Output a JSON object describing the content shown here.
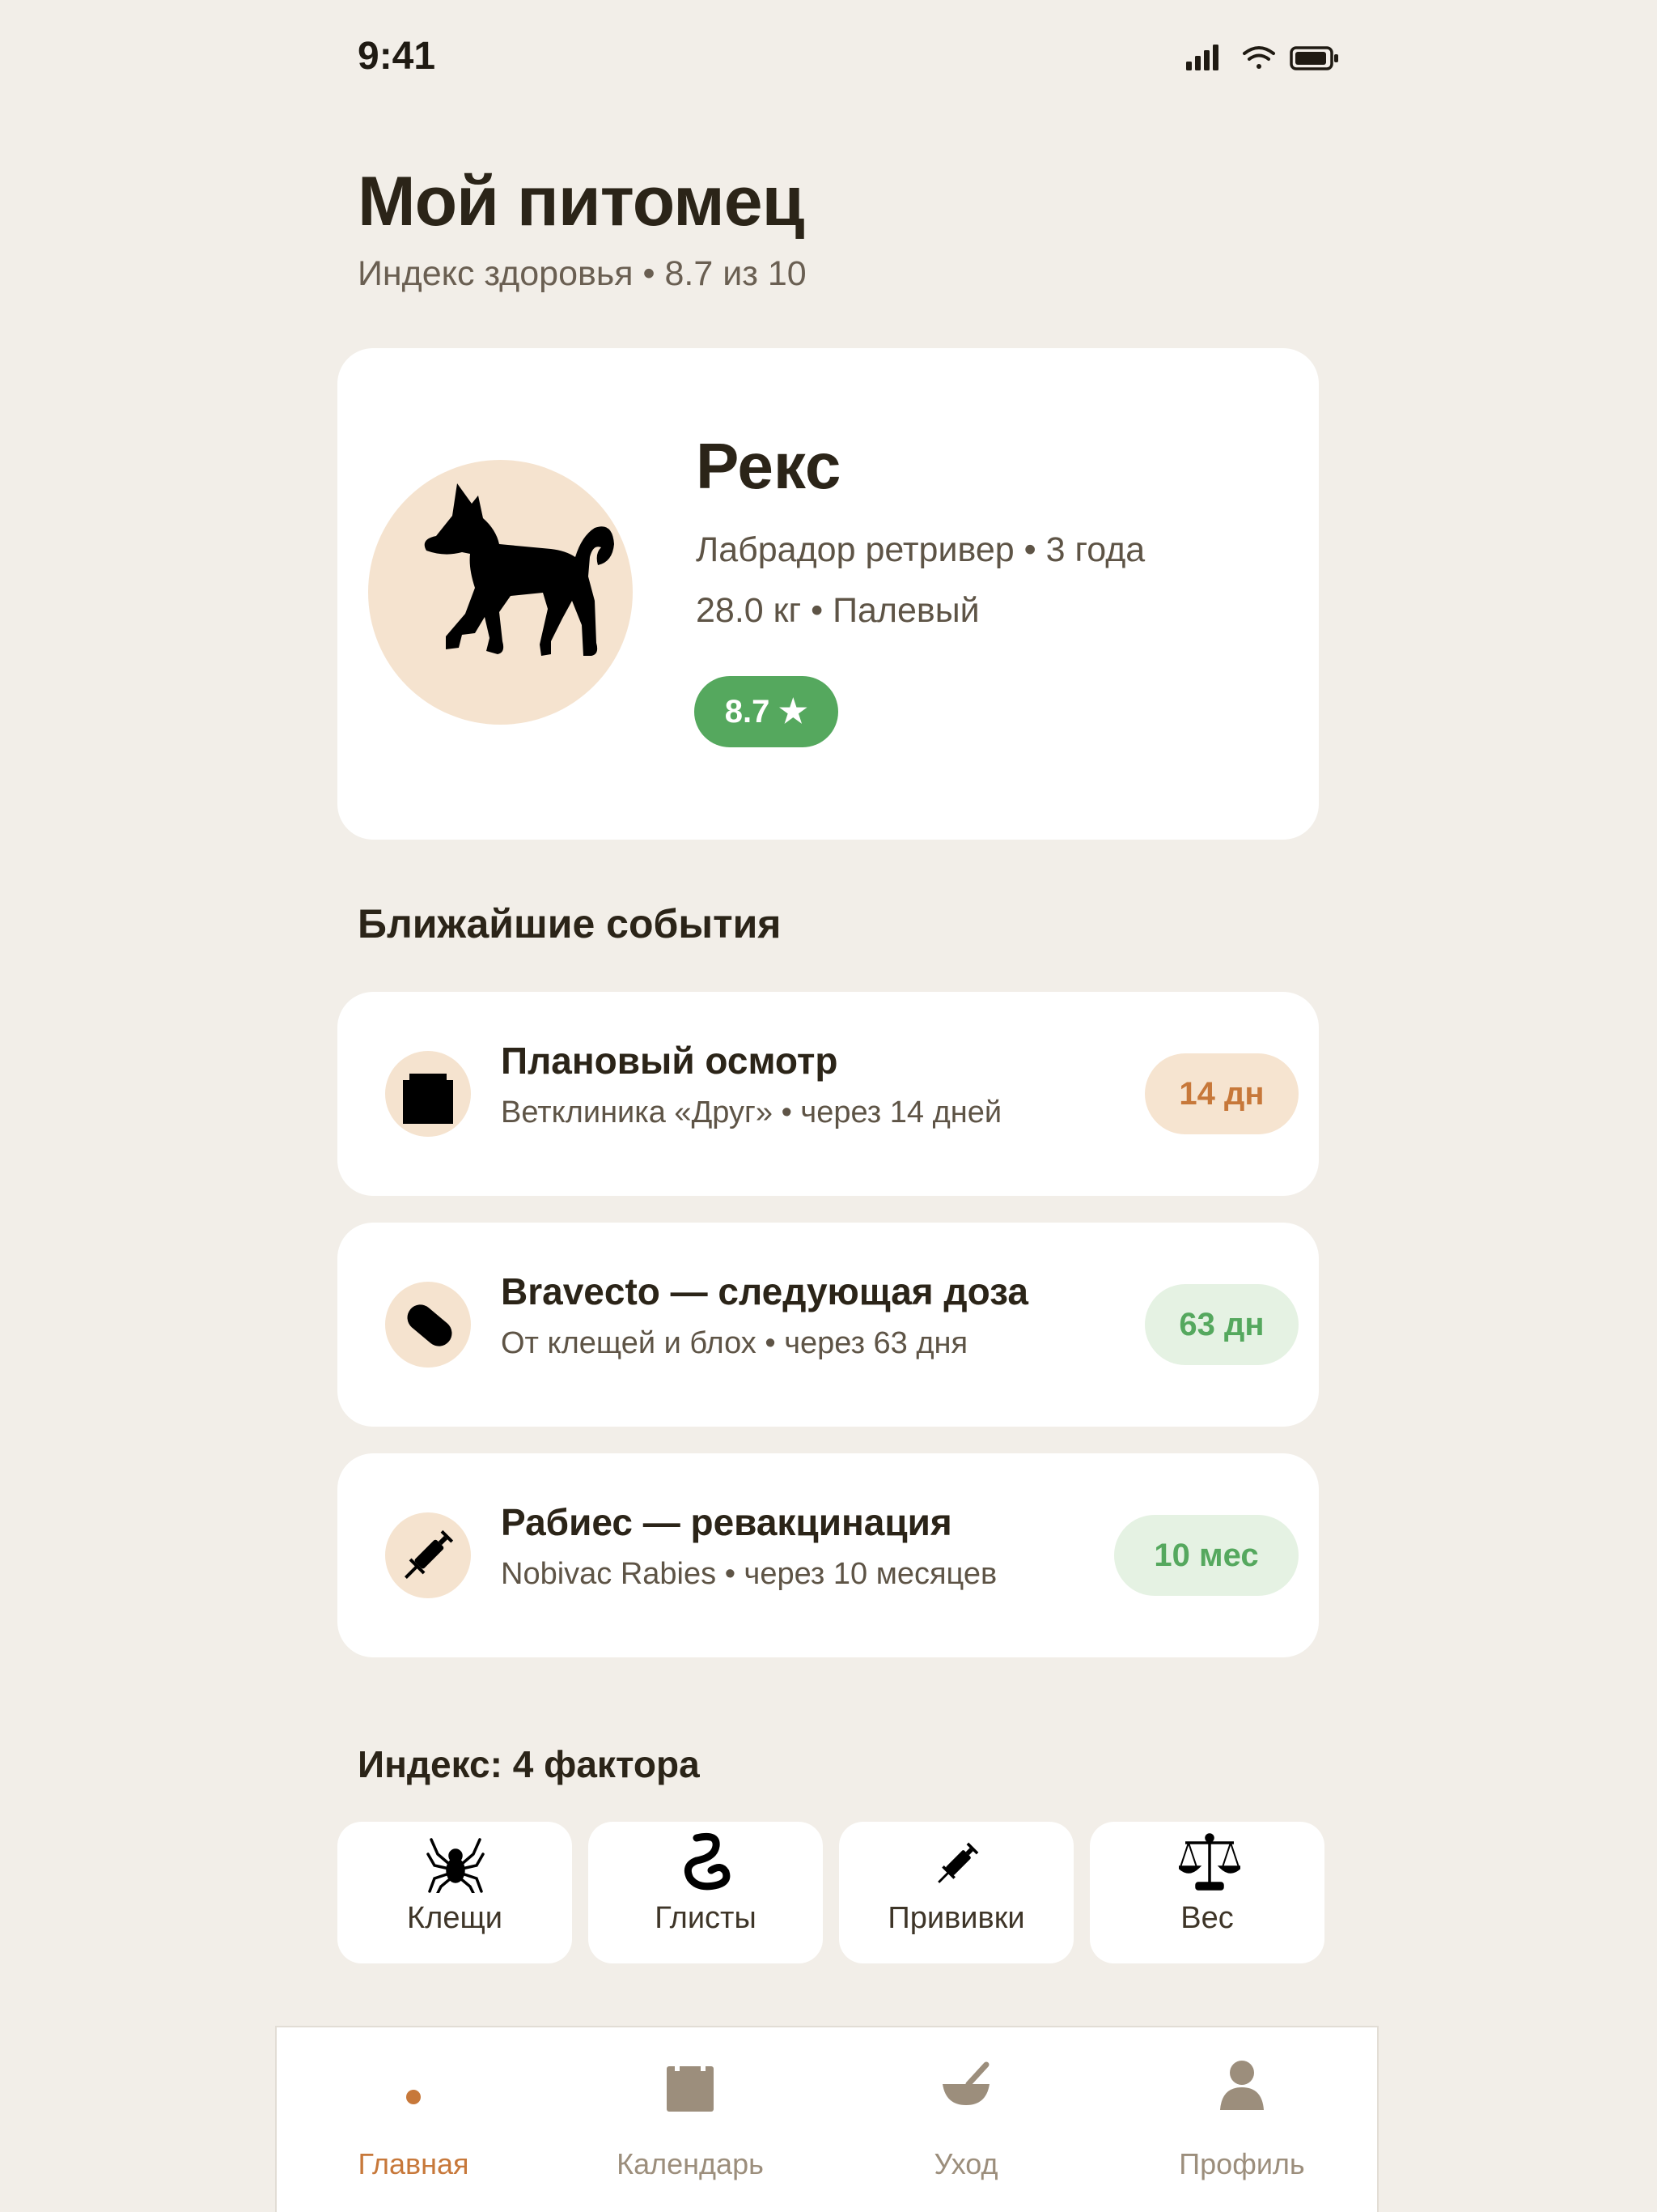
{
  "status_bar": {
    "time": "9:41"
  },
  "header": {
    "title": "Мой питомец",
    "subtitle": "Индекс здоровья • 8.7 из 10"
  },
  "pet": {
    "name": "Рекс",
    "details_line1": "Лабрадор ретривер • 3 года",
    "details_line2": "28.0 кг • Палевый",
    "score_badge": "8.7 ★",
    "avatar_icon": "dog-silhouette-icon"
  },
  "events_section": {
    "title": "Ближайшие события",
    "items": [
      {
        "title": "Плановый осмотр",
        "subtitle": "Ветклиника «Друг» • через 14 дней",
        "badge": "14 дн",
        "icon": "clinic-icon",
        "badge_color": "#C7783A"
      },
      {
        "title": "Bravecto — следующая доза",
        "subtitle": "От клещей и блох • через 63 дня",
        "badge": "63 дн",
        "icon": "pill-icon",
        "badge_color": "#55A85E"
      },
      {
        "title": "Рабиес — ревакцинация",
        "subtitle": "Nobivac Rabies • через 10 месяцев",
        "badge": "10 мес",
        "icon": "syringe-icon",
        "badge_color": "#55A85E"
      }
    ]
  },
  "factors_section": {
    "title": "Индекс: 4 фактора",
    "items": [
      {
        "label": "Клещи",
        "icon": "spider-icon"
      },
      {
        "label": "Глисты",
        "icon": "worm-icon"
      },
      {
        "label": "Прививки",
        "icon": "syringe-icon"
      },
      {
        "label": "Вес",
        "icon": "scales-icon"
      }
    ]
  },
  "tabbar": {
    "items": [
      {
        "label": "Главная",
        "icon": "home-dot-icon",
        "active": true
      },
      {
        "label": "Календарь",
        "icon": "calendar-icon",
        "active": false
      },
      {
        "label": "Уход",
        "icon": "bowl-icon",
        "active": false
      },
      {
        "label": "Профиль",
        "icon": "person-icon",
        "active": false
      }
    ]
  },
  "colors": {
    "background": "#F2EEE8",
    "accent": "#C7783A",
    "success": "#55A85E",
    "icon_bg": "#F5E3CF"
  }
}
